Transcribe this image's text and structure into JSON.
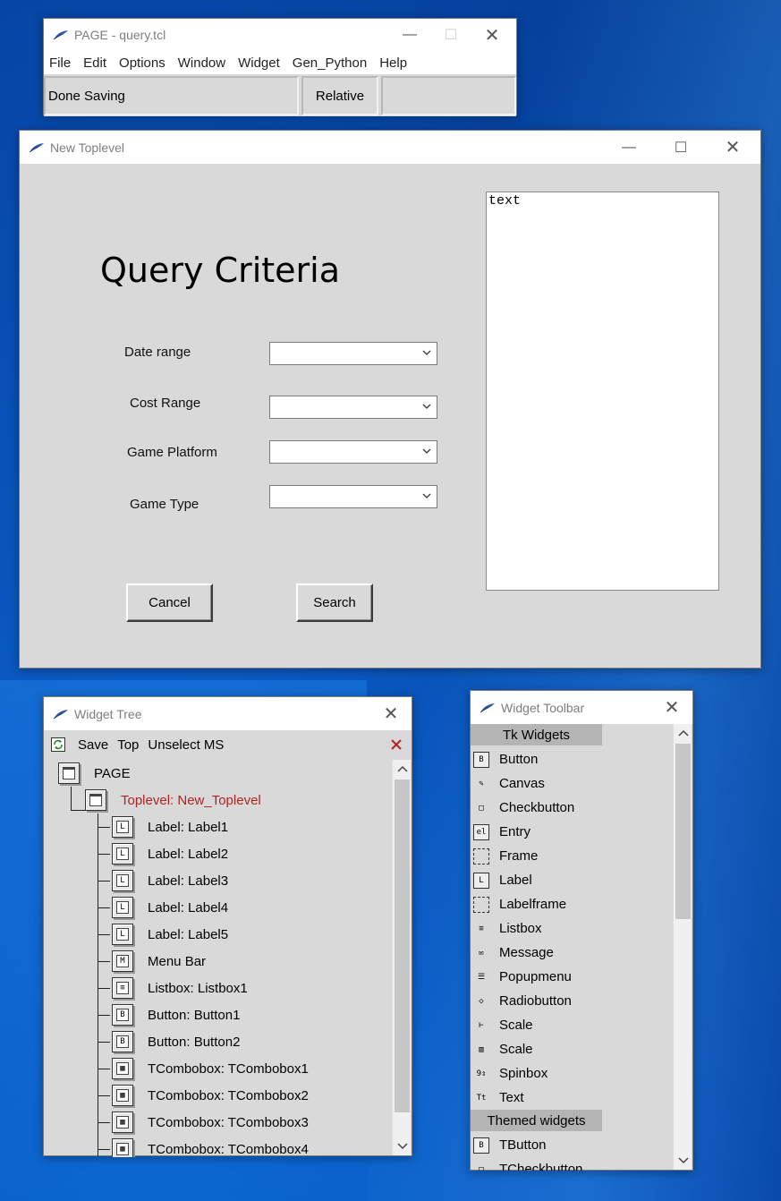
{
  "page_window": {
    "title": "PAGE - query.tcl",
    "menu": [
      "File",
      "Edit",
      "Options",
      "Window",
      "Widget",
      "Gen_Python",
      "Help"
    ],
    "status": "Done Saving",
    "mode": "Relative",
    "extra": ""
  },
  "toplevel": {
    "title": "New Toplevel",
    "heading": "Query Criteria",
    "labels": [
      "Date range",
      "Cost Range",
      "Game Platform",
      "Game Type"
    ],
    "cancel_label": "Cancel",
    "search_label": "Search",
    "text_content": "text"
  },
  "widget_tree": {
    "title": "Widget Tree",
    "toolbar": [
      "Save",
      "Top",
      "Unselect MS"
    ],
    "root": "PAGE",
    "toplevel": "Toplevel: New_Toplevel",
    "children": [
      {
        "label": "Label: Label1",
        "icon": "L"
      },
      {
        "label": "Label: Label2",
        "icon": "L"
      },
      {
        "label": "Label: Label3",
        "icon": "L"
      },
      {
        "label": "Label: Label4",
        "icon": "L"
      },
      {
        "label": "Label: Label5",
        "icon": "L"
      },
      {
        "label": "Menu Bar",
        "icon": "M"
      },
      {
        "label": "Listbox: Listbox1",
        "icon": "≡"
      },
      {
        "label": "Button: Button1",
        "icon": "B"
      },
      {
        "label": "Button: Button2",
        "icon": "B"
      },
      {
        "label": "TCombobox: TCombobox1",
        "icon": "▦"
      },
      {
        "label": "TCombobox: TCombobox2",
        "icon": "▦"
      },
      {
        "label": "TCombobox: TCombobox3",
        "icon": "▦"
      },
      {
        "label": "TCombobox: TCombobox4",
        "icon": "▦"
      }
    ],
    "toplevel_color": "#b22222"
  },
  "widget_toolbar": {
    "title": "Widget Toolbar",
    "tk_header": "Tk Widgets",
    "tk_items": [
      {
        "label": "Button",
        "icon": "B",
        "style": "boxed"
      },
      {
        "label": "Canvas",
        "icon": "✎",
        "style": "plain"
      },
      {
        "label": "Checkbutton",
        "icon": "□",
        "style": "plain"
      },
      {
        "label": "Entry",
        "icon": "el",
        "style": "boxed"
      },
      {
        "label": "Frame",
        "icon": "",
        "style": "dashed"
      },
      {
        "label": "Label",
        "icon": "L",
        "style": "boxed"
      },
      {
        "label": "Labelframe",
        "icon": "",
        "style": "dashed"
      },
      {
        "label": "Listbox",
        "icon": "≡",
        "style": "plain"
      },
      {
        "label": "Message",
        "icon": "✉",
        "style": "plain"
      },
      {
        "label": "Popupmenu",
        "icon": "☰",
        "style": "plain"
      },
      {
        "label": "Radiobutton",
        "icon": "◇",
        "style": "plain"
      },
      {
        "label": "Scale",
        "icon": "⊢",
        "style": "plain"
      },
      {
        "label": "Scale",
        "icon": "▥",
        "style": "plain"
      },
      {
        "label": "Spinbox",
        "icon": "9⇕",
        "style": "plain"
      },
      {
        "label": "Text",
        "icon": "Tt",
        "style": "plain"
      }
    ],
    "themed_header": "Themed widgets",
    "themed_items": [
      {
        "label": "TButton",
        "icon": "B",
        "style": "boxed"
      },
      {
        "label": "TCheckbutton",
        "icon": "□",
        "style": "plain"
      }
    ]
  }
}
